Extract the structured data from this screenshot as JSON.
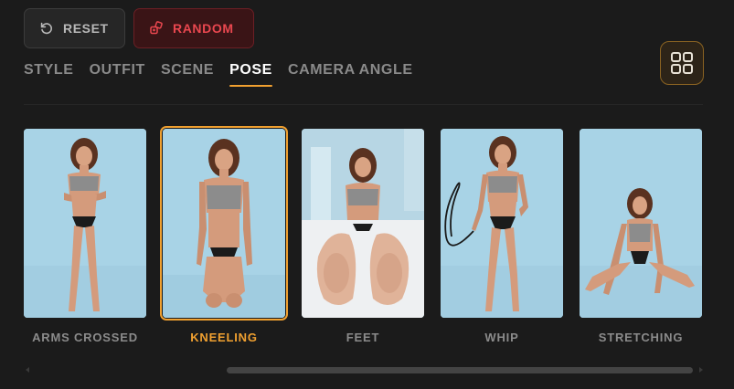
{
  "toolbar": {
    "reset_label": "RESET",
    "random_label": "RANDOM"
  },
  "tabs": [
    {
      "label": "STYLE",
      "active": false
    },
    {
      "label": "OUTFIT",
      "active": false
    },
    {
      "label": "SCENE",
      "active": false
    },
    {
      "label": "POSE",
      "active": true
    },
    {
      "label": "CAMERA ANGLE",
      "active": false
    }
  ],
  "poses": [
    {
      "label": "ARMS CROSSED",
      "selected": false
    },
    {
      "label": "KNEELING",
      "selected": true
    },
    {
      "label": "FEET",
      "selected": false
    },
    {
      "label": "WHIP",
      "selected": false
    },
    {
      "label": "STRETCHING",
      "selected": false
    }
  ],
  "colors": {
    "accent": "#f0a030",
    "random_red": "#e9474f",
    "background": "#1b1b1b",
    "thumb_bg": "#a9d4e6"
  }
}
